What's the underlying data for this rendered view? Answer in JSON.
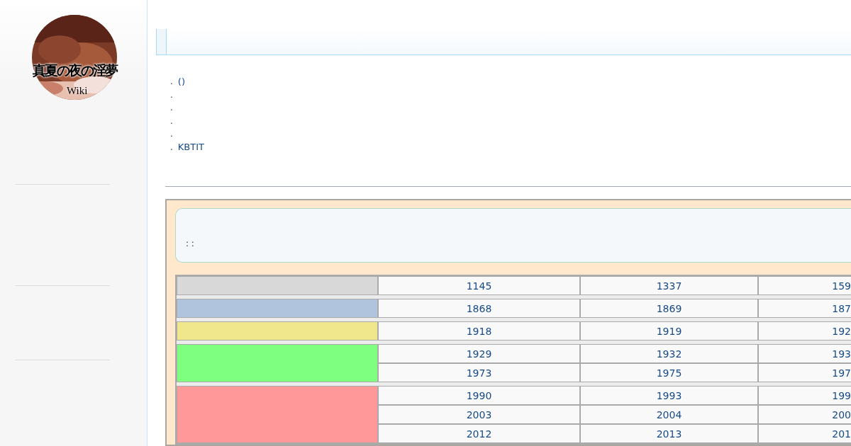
{
  "logo": {
    "title": "真夏の夜の淫夢",
    "subtitle": "Wiki"
  },
  "list": [
    {
      "bullet": ".",
      "text": "()"
    },
    {
      "bullet": "."
    },
    {
      "bullet": "."
    },
    {
      "bullet": "."
    },
    {
      "bullet": "."
    },
    {
      "bullet": ".",
      "text": "KBTIT"
    }
  ],
  "notice": {
    "text": ": :"
  },
  "groups": [
    {
      "color": "#d8d8d8",
      "rows": [
        [
          "1145",
          "1337",
          "159"
        ]
      ]
    },
    {
      "color": "#b0c4de",
      "rows": [
        [
          "1868",
          "1869",
          "187"
        ]
      ]
    },
    {
      "color": "#f0e68c",
      "rows": [
        [
          "1918",
          "1919",
          "192"
        ]
      ]
    },
    {
      "color": "#7fff7f",
      "rows": [
        [
          "1929",
          "1932",
          "193"
        ],
        [
          "1973",
          "1975",
          "197"
        ]
      ]
    },
    {
      "color": "#ff9999",
      "rows": [
        [
          "1990",
          "1993",
          "199"
        ],
        [
          "2003",
          "2004",
          "200"
        ],
        [
          "2012",
          "2013",
          "201"
        ]
      ]
    }
  ]
}
